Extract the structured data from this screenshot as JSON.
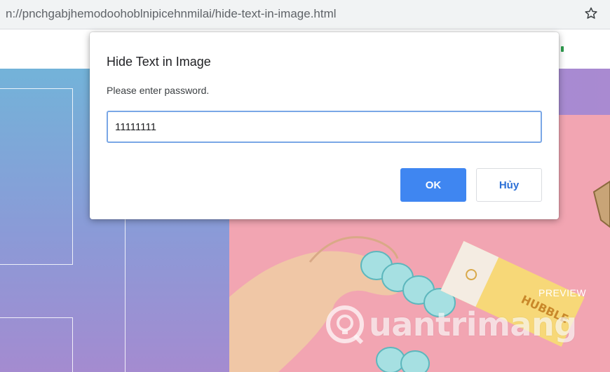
{
  "browser": {
    "url": "n://pnchgabjhemodoohoblnipicehnmilai/hide-text-in-image.html",
    "star_icon": "star-outline-icon"
  },
  "dialog": {
    "title": "Hide Text in Image",
    "message": "Please enter password.",
    "input_value": "11111111",
    "ok_label": "OK",
    "cancel_label": "Hủy"
  },
  "page": {
    "preview_label": "PREVIEW",
    "watermark_text": "uantrimang",
    "watermark_icon": "quantrimang-logo-icon"
  },
  "colors": {
    "accent": "#3f86f1",
    "left_gradient_top": "#73b3d9",
    "left_gradient_bottom": "#a48bd0",
    "pink": "#f2a5b2"
  }
}
